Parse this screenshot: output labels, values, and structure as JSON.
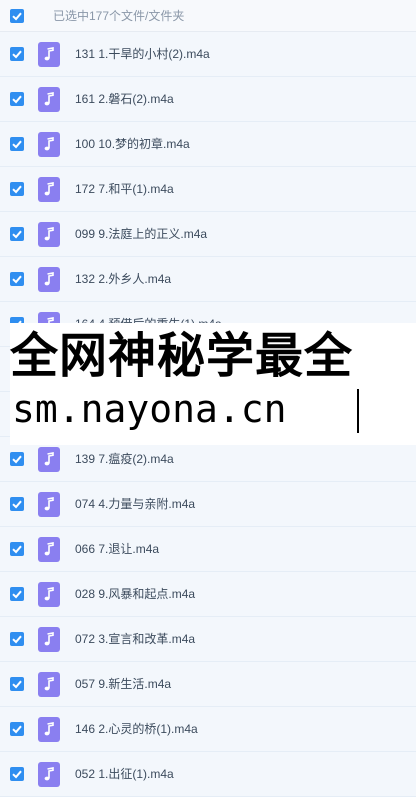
{
  "header": {
    "selection_text": "已选中177个文件/文件夹"
  },
  "files": [
    "131 1.干旱的小村(2).m4a",
    "161 2.磐石(2).m4a",
    "100 10.梦的初章.m4a",
    "172 7.和平(1).m4a",
    "099 9.法庭上的正义.m4a",
    "132 2.外乡人.m4a",
    "164 4.预借后的重生(1).m4a",
    "",
    "",
    "139 7.瘟疫(2).m4a",
    "074 4.力量与亲附.m4a",
    "066 7.退让.m4a",
    "028 9.风暴和起点.m4a",
    "072 3.宣言和改革.m4a",
    "057 9.新生活.m4a",
    "146 2.心灵的桥(1).m4a",
    "052 1.出征(1).m4a"
  ],
  "watermark": {
    "line1": "全网神秘学最全",
    "line2": "sm.nayona.cn"
  },
  "colors": {
    "checkbox": "#2f8ef0",
    "audio_icon": "#8a7ff0",
    "row_bg": "#f3f7fc"
  }
}
